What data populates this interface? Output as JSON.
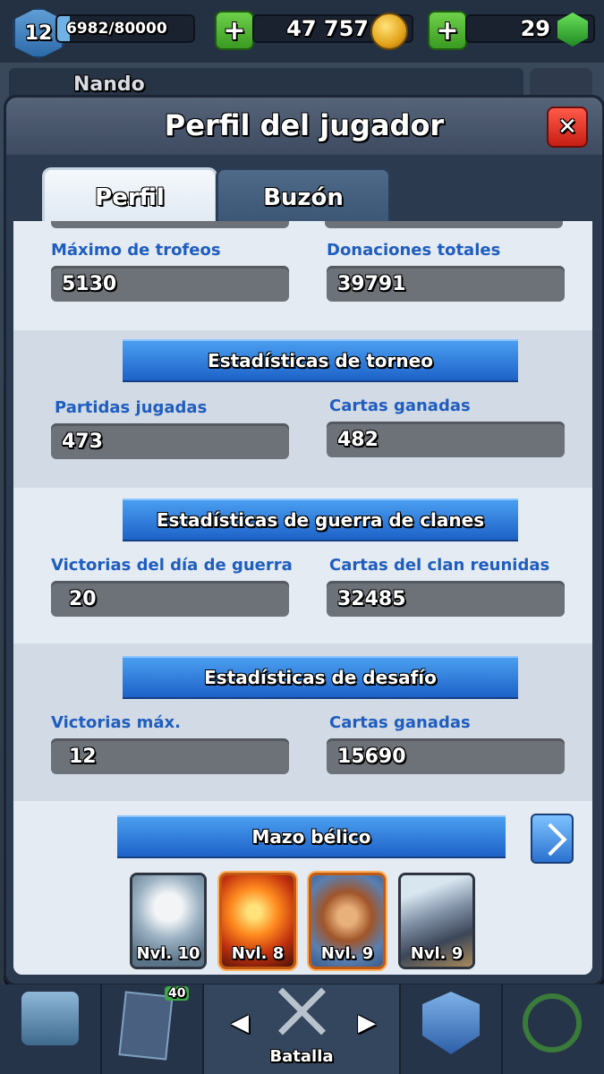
{
  "topbar": {
    "level": "12",
    "xp": "6982/80000",
    "xp_progress": 0.087,
    "gold": "47 757",
    "gems": "29"
  },
  "behind": {
    "player_name": "Nando"
  },
  "modal": {
    "title": "Perfil del jugador",
    "tabs": [
      {
        "label": "Perfil",
        "active": true
      },
      {
        "label": "Buzón",
        "active": false
      }
    ]
  },
  "stats": {
    "max_trophies_label": "Máximo de trofeos",
    "max_trophies": "5130",
    "total_donations_label": "Donaciones totales",
    "total_donations": "39791"
  },
  "tournament": {
    "title": "Estadísticas de torneo",
    "games_label": "Partidas jugadas",
    "games": "473",
    "cards_label": "Cartas ganadas",
    "cards": "482"
  },
  "clan_war": {
    "title": "Estadísticas de guerra de clanes",
    "wins_label": "Victorias del día de guerra",
    "wins": "20",
    "cards_label": "Cartas del clan reunidas",
    "cards": "32485"
  },
  "challenge": {
    "title": "Estadísticas de desafío",
    "max_wins_label": "Victorias máx.",
    "max_wins": "12",
    "cards_label": "Cartas ganadas",
    "cards": "15690"
  },
  "war_deck": {
    "title": "Mazo bélico",
    "cards": [
      {
        "name": "skeleton-card",
        "level": "Nvl. 10"
      },
      {
        "name": "fireball-card",
        "level": "Nvl. 8"
      },
      {
        "name": "hog-rider-card",
        "level": "Nvl. 9"
      },
      {
        "name": "cannon-card",
        "level": "Nvl. 9"
      }
    ]
  },
  "bottom_nav": {
    "battle_label": "Batalla",
    "cards_badge": "40"
  },
  "colors": {
    "accent_blue": "#1e62c8",
    "label_blue": "#1f5dbf",
    "close_red": "#c81e14",
    "plus_green": "#3a9a22"
  }
}
